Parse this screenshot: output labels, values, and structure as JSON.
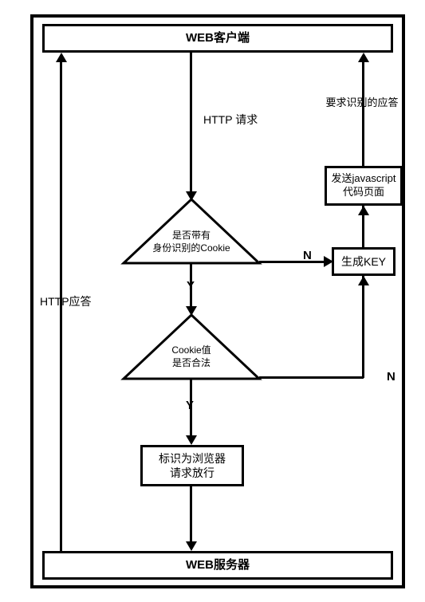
{
  "nodes": {
    "client": "WEB客户端",
    "server": "WEB服务器",
    "decision_cookie": "是否带有\n身份识别的Cookie",
    "decision_valid": "Cookie值\n是否合法",
    "gen_key": "生成KEY",
    "send_js": "发送javascript\n代码页面",
    "allow": "标识为浏览器\n请求放行"
  },
  "labels": {
    "http_request": "HTTP 请求",
    "http_response": "HTTP应答",
    "response_identify": "要求识别的应答",
    "yes": "Y",
    "no": "N"
  }
}
